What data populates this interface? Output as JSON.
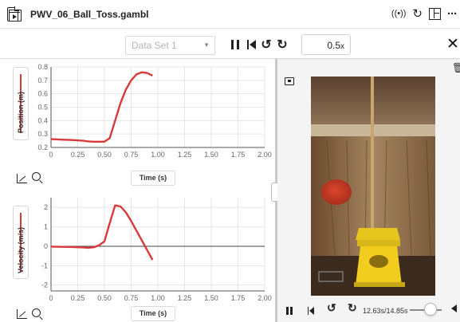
{
  "window": {
    "title": "PWV_06_Ball_Toss.gambl"
  },
  "toolbar": {
    "dataset_label": "Data Set 1",
    "speed_value": "0.5",
    "speed_unit": "x"
  },
  "graphs": [
    {
      "ylabel": "Position (m)",
      "xlabel": "Time (s)",
      "y_ticks": [
        "0.8",
        "0.7",
        "0.6",
        "0.5",
        "0.4",
        "0.3",
        "0.2"
      ],
      "x_ticks": [
        "0",
        "0.25",
        "0.50",
        "0.75",
        "1.00",
        "1.25",
        "1.50",
        "1.75",
        "2.00"
      ]
    },
    {
      "ylabel": "Velocity (m/s)",
      "xlabel": "Time (s)",
      "y_ticks": [
        "2",
        "1",
        "0",
        "-1",
        "-2"
      ],
      "x_ticks": [
        "0",
        "0.25",
        "0.50",
        "0.75",
        "1.00",
        "1.25",
        "1.50",
        "1.75",
        "2.00"
      ]
    }
  ],
  "video": {
    "time_display": "12.63s/14.85s"
  },
  "chart_data": [
    {
      "type": "line",
      "title": "",
      "xlabel": "Time (s)",
      "ylabel": "Position (m)",
      "xlim": [
        0,
        2
      ],
      "ylim": [
        0.2,
        0.8
      ],
      "grid": true,
      "series": [
        {
          "color": "#d8393a",
          "x": [
            0,
            0.1,
            0.2,
            0.3,
            0.35,
            0.4,
            0.45,
            0.5,
            0.55,
            0.6,
            0.65,
            0.7,
            0.75,
            0.8,
            0.85,
            0.9,
            0.95
          ],
          "y": [
            0.262,
            0.258,
            0.255,
            0.25,
            0.245,
            0.243,
            0.243,
            0.243,
            0.27,
            0.4,
            0.53,
            0.63,
            0.7,
            0.745,
            0.76,
            0.755,
            0.735
          ]
        }
      ]
    },
    {
      "type": "line",
      "title": "",
      "xlabel": "Time (s)",
      "ylabel": "Velocity (m/s)",
      "xlim": [
        0,
        2
      ],
      "ylim": [
        -2.3,
        2.5
      ],
      "grid": true,
      "series": [
        {
          "color": "#d8393a",
          "x": [
            0,
            0.1,
            0.2,
            0.3,
            0.35,
            0.4,
            0.45,
            0.5,
            0.55,
            0.6,
            0.65,
            0.7,
            0.75,
            0.8,
            0.85,
            0.9,
            0.95
          ],
          "y": [
            -0.02,
            -0.03,
            -0.04,
            -0.06,
            -0.08,
            -0.05,
            0.05,
            0.25,
            1.2,
            2.1,
            2.05,
            1.75,
            1.3,
            0.8,
            0.3,
            -0.2,
            -0.7
          ]
        }
      ]
    }
  ]
}
